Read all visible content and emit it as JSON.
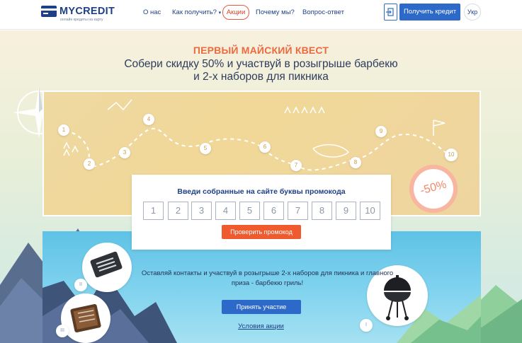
{
  "header": {
    "logo_text": "MYCREDIT",
    "logo_subtitle": "онлайн кредиты на карту",
    "nav": {
      "about": "О нас",
      "how": "Как получить?",
      "promo": "Акции",
      "why": "Почему мы?",
      "faq": "Вопрос-ответ"
    },
    "get_credit": "Получить кредит",
    "lang": "Укр"
  },
  "hero": {
    "title": "ПЕРВЫЙ МАЙСКИЙ КВЕСТ",
    "subtitle_line1": "Собери скидку 50% и участвуй в розыгрыше барбекю",
    "subtitle_line2": "и 2-х наборов для пикника"
  },
  "map": {
    "steps": [
      "1",
      "2",
      "3",
      "4",
      "5",
      "6",
      "7",
      "8",
      "9",
      "10"
    ],
    "discount": "-50%"
  },
  "promo": {
    "label": "Введи собранные на сайте буквы промокода",
    "boxes": [
      "1",
      "2",
      "3",
      "4",
      "5",
      "6",
      "7",
      "8",
      "9",
      "10"
    ],
    "check_button": "Проверить промокод"
  },
  "prizes": {
    "text_line1": "Оставляй контакты и участвуй в розыгрыше 2-х наборов для пикника и главного",
    "text_line2": "приза - барбекю гриль!",
    "join_button": "Принять участие",
    "terms_link": "Условия акции",
    "labels": [
      "II",
      "III",
      "I"
    ]
  },
  "colors": {
    "brand": "#1f3f86",
    "accent_orange": "#ef5a2f",
    "button_blue": "#2d69c8"
  }
}
